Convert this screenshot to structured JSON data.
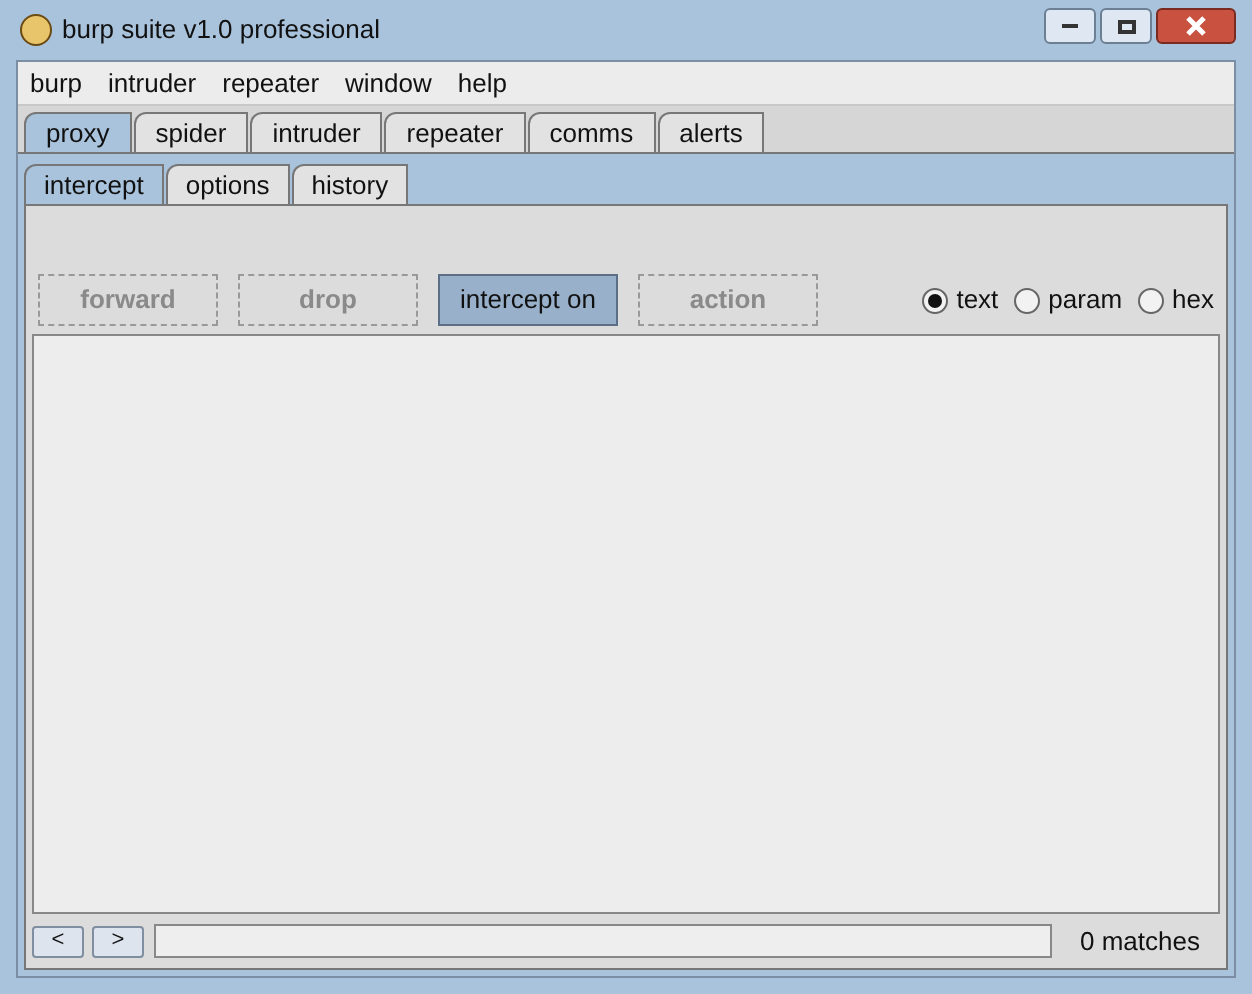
{
  "window": {
    "title": "burp suite v1.0  professional"
  },
  "menu": [
    "burp",
    "intruder",
    "repeater",
    "window",
    "help"
  ],
  "tabs": [
    {
      "label": "proxy",
      "selected": true
    },
    {
      "label": "spider",
      "selected": false
    },
    {
      "label": "intruder",
      "selected": false
    },
    {
      "label": "repeater",
      "selected": false
    },
    {
      "label": "comms",
      "selected": false
    },
    {
      "label": "alerts",
      "selected": false
    }
  ],
  "subtabs": [
    {
      "label": "intercept",
      "selected": true
    },
    {
      "label": "options",
      "selected": false
    },
    {
      "label": "history",
      "selected": false
    }
  ],
  "buttons": [
    {
      "label": "forward",
      "disabled": true,
      "pressed": false
    },
    {
      "label": "drop",
      "disabled": true,
      "pressed": false
    },
    {
      "label": "intercept on",
      "disabled": false,
      "pressed": true
    },
    {
      "label": "action",
      "disabled": true,
      "pressed": false
    }
  ],
  "view_modes": [
    {
      "label": "text",
      "selected": true
    },
    {
      "label": "param",
      "selected": false
    },
    {
      "label": "hex",
      "selected": false
    }
  ],
  "search": {
    "prev": "<",
    "next": ">",
    "matches": "0 matches"
  }
}
